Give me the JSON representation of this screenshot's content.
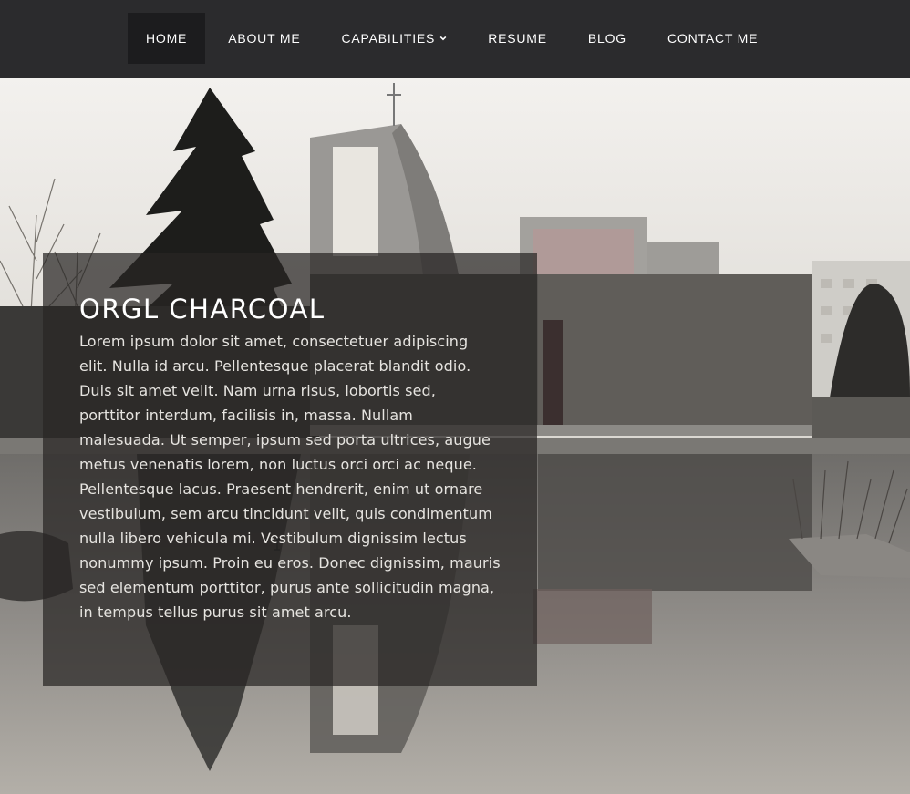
{
  "nav": {
    "items": [
      {
        "label": "HOME",
        "active": true
      },
      {
        "label": "ABOUT ME"
      },
      {
        "label": "CAPABILITIES",
        "dropdown": true,
        "icon": "chevron-down-icon"
      },
      {
        "label": "RESUME"
      },
      {
        "label": "BLOG"
      },
      {
        "label": "CONTACT ME"
      }
    ]
  },
  "hero": {
    "title": "ORGL CHARCOAL",
    "body": "Lorem ipsum dolor sit amet, consectetuer adipiscing elit. Nulla id arcu. Pellentesque placerat blandit odio. Duis sit amet velit. Nam urna risus, lobortis sed, porttitor interdum, facilisis in, massa. Nullam malesuada. Ut semper, ipsum sed porta ultrices, augue metus venenatis lorem, non luctus orci orci ac neque. Pellentesque lacus. Praesent hendrerit, enim ut ornare vestibulum, sem arcu tincidunt velit, quis condimentum nulla libero vehicula mi. Vestibulum dignissim lectus nonummy ipsum. Proin eu eros. Donec dignissim, mauris sed elementum porttitor, purus ante sollicitudin magna, in tempus tellus purus sit amet arcu.",
    "background_image": "church-building-reflecting-pool-photo"
  },
  "colors": {
    "navbar_bg": "#2b2b2d",
    "nav_active_bg": "#1c1c1e",
    "nav_text": "#ffffff",
    "panel_bg": "rgba(40,38,36,0.72)"
  }
}
